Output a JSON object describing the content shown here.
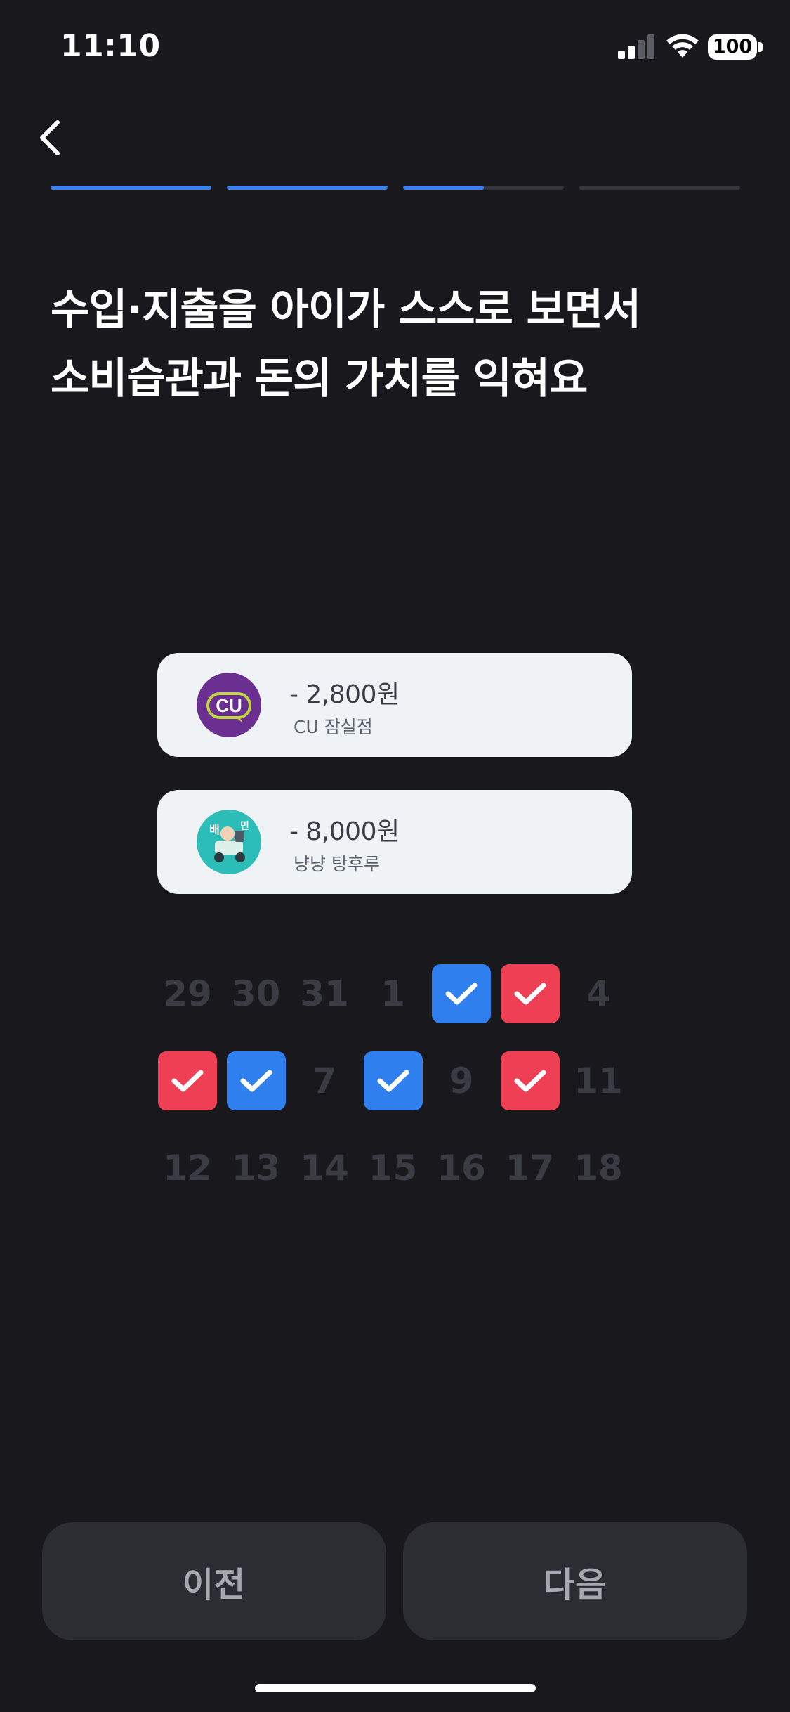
{
  "status_bar": {
    "time": "11:10",
    "battery": "100",
    "signal_icon": "cellular-signal-icon",
    "wifi_icon": "wifi-icon"
  },
  "nav": {
    "back_icon": "chevron-left-icon"
  },
  "progress": {
    "total_steps": 4,
    "segments": [
      1.0,
      1.0,
      0.5,
      0.0
    ],
    "color_active": "#3a83ee",
    "color_inactive": "#35363d"
  },
  "headline": {
    "line1": "수입·지출을 아이가 스스로 보면서",
    "line2": "소비습관과 돈의 가치를 익혀요"
  },
  "transactions": [
    {
      "amount": "- 2,800원",
      "merchant": "CU 잠실점",
      "logo": "cu-logo"
    },
    {
      "amount": "- 8,000원",
      "merchant": "냥냥 탕후루",
      "logo": "baemin-logo"
    }
  ],
  "calendar": {
    "rows": [
      [
        {
          "label": "29"
        },
        {
          "label": "30"
        },
        {
          "label": "31"
        },
        {
          "label": "1"
        },
        {
          "label": "",
          "check": "blue"
        },
        {
          "label": "",
          "check": "red"
        },
        {
          "label": "4"
        }
      ],
      [
        {
          "label": "",
          "check": "red"
        },
        {
          "label": "",
          "check": "blue"
        },
        {
          "label": "7"
        },
        {
          "label": "",
          "check": "blue"
        },
        {
          "label": "9"
        },
        {
          "label": "",
          "check": "red"
        },
        {
          "label": "11"
        }
      ],
      [
        {
          "label": "12"
        },
        {
          "label": "13"
        },
        {
          "label": "14"
        },
        {
          "label": "15"
        },
        {
          "label": "16"
        },
        {
          "label": "17"
        },
        {
          "label": "18"
        }
      ]
    ],
    "colors": {
      "blue": "#2f80ee",
      "red": "#ef3f55"
    }
  },
  "buttons": {
    "prev_label": "이전",
    "next_label": "다음"
  }
}
